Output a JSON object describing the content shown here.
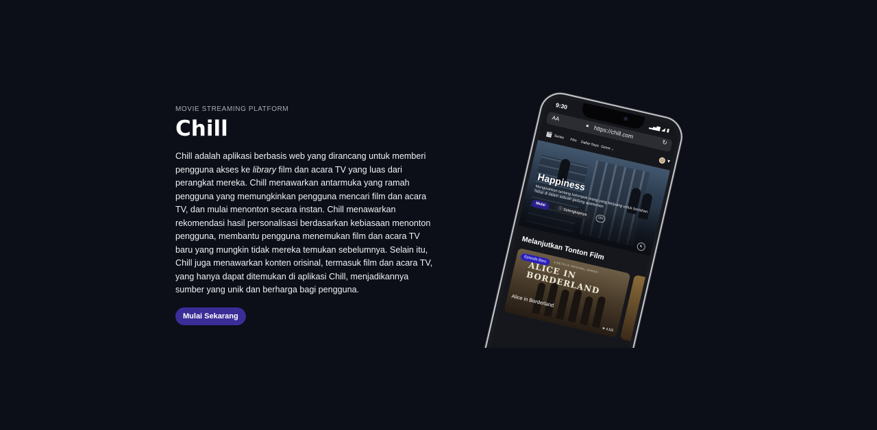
{
  "hero": {
    "eyebrow": "MOVIE STREAMING PLATFORM",
    "title": "Chill",
    "description_before": "Chill adalah aplikasi berbasis web yang dirancang untuk memberi pengguna akses ke ",
    "description_emphasis": "library",
    "description_after": " film dan acara TV yang luas dari perangkat mereka. Chill menawarkan antarmuka yang ramah pengguna yang memungkinkan pengguna mencari film dan acara TV, dan mulai menonton secara instan. Chill menawarkan rekomendasi hasil personalisasi berdasarkan kebiasaan menonton pengguna, membantu pengguna menemukan film dan acara TV baru yang mungkin tidak mereka temukan sebelumnya. Selain itu, Chill juga menawarkan konten orisinal, termasuk film dan acara TV, yang hanya dapat ditemukan di aplikasi Chill, menjadikannya sumber yang unik dan berharga bagi pengguna.",
    "cta_label": "Mulai Sekarang"
  },
  "phone": {
    "status_time": "9:30",
    "status_icons": "▂▄▆ ◢ ▮",
    "browser": {
      "text_size_label": "AA",
      "url": "https://chill.com"
    },
    "nav": {
      "logo_icon": "film-icon",
      "links": [
        "Series",
        "Film",
        "Daftar Saya",
        "Genre ⌄"
      ]
    },
    "banner": {
      "title": "Happiness",
      "description": "Mengisahkan tentang kelompok orang yang berjuang untuk bertahan hidup di dalam sebuah gedung apartemen",
      "play_label": "Mulai",
      "more_label": "ⓘ Selengkapnya",
      "age_rating": "18+"
    },
    "continue_section": {
      "title": "Melanjutkan Tonton Film",
      "card": {
        "badge": "Episode Baru",
        "brand": "A NETFLIX ORIGINAL SERIES",
        "show_title": "ALICE IN BORDERLAND",
        "label": "Alice in Borderland",
        "rating": "★ 4.5/5"
      }
    }
  },
  "colors": {
    "background": "#0c0e18",
    "accent": "#3b2d97",
    "text": "#ffffff"
  }
}
